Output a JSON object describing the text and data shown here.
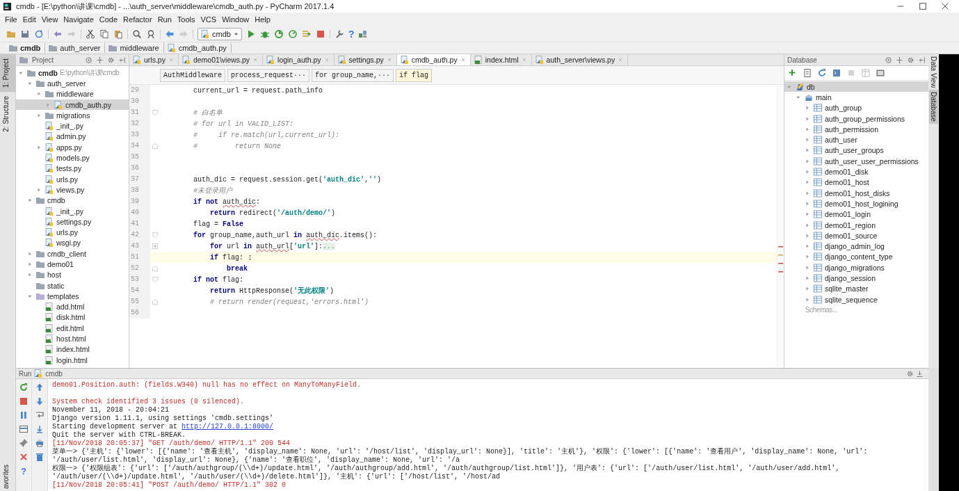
{
  "window": {
    "title": "cmdb - [E:\\python\\讲课\\cmdb] - ...\\auth_server\\middleware\\cmdb_auth.py - PyCharm 2017.1.4"
  },
  "menu": [
    "File",
    "Edit",
    "View",
    "Navigate",
    "Code",
    "Refactor",
    "Run",
    "Tools",
    "VCS",
    "Window",
    "Help"
  ],
  "toolbar": {
    "run_config": "cmdb",
    "help_glyph": "?"
  },
  "nav_bar": [
    {
      "label": "cmdb",
      "kind": "folder"
    },
    {
      "label": "auth_server",
      "kind": "folder"
    },
    {
      "label": "middleware",
      "kind": "folder"
    },
    {
      "label": "cmdb_auth.py",
      "kind": "py"
    }
  ],
  "left_strip": [
    {
      "label": "1: Project",
      "selected": true
    },
    {
      "label": "2: Structure",
      "selected": false
    },
    {
      "label": "avorites",
      "selected": false
    }
  ],
  "project": {
    "title": "Project",
    "tree": [
      {
        "label": "cmdb",
        "kind": "folder",
        "path": "E:\\python\\讲课\\cmdb",
        "expanded": true,
        "selected": false,
        "children": [
          {
            "label": "auth_server",
            "kind": "folder",
            "expanded": true,
            "selected": false,
            "children": [
              {
                "label": "middleware",
                "kind": "folder",
                "expanded": true,
                "selected": false,
                "children": [
                  {
                    "label": "cmdb_auth.py",
                    "kind": "py",
                    "expanded": false,
                    "selected": true
                  }
                ]
              },
              {
                "label": "migrations",
                "kind": "folder",
                "expanded": false,
                "selected": false
              },
              {
                "label": "_init_.py",
                "kind": "py",
                "selected": false
              },
              {
                "label": "admin.py",
                "kind": "py",
                "selected": false
              },
              {
                "label": "apps.py",
                "kind": "py",
                "expanded": false,
                "selected": false
              },
              {
                "label": "models.py",
                "kind": "py",
                "selected": false
              },
              {
                "label": "tests.py",
                "kind": "py",
                "selected": false
              },
              {
                "label": "urls.py",
                "kind": "py",
                "selected": false
              },
              {
                "label": "views.py",
                "kind": "py",
                "expanded": false,
                "selected": false
              }
            ]
          },
          {
            "label": "cmdb",
            "kind": "folder",
            "expanded": true,
            "selected": false,
            "children": [
              {
                "label": "_init_.py",
                "kind": "py",
                "selected": false
              },
              {
                "label": "settings.py",
                "kind": "py",
                "selected": false
              },
              {
                "label": "urls.py",
                "kind": "py",
                "selected": false
              },
              {
                "label": "wsgi.py",
                "kind": "py",
                "selected": false
              }
            ]
          },
          {
            "label": "cmdb_client",
            "kind": "folder",
            "expanded": false,
            "selected": false
          },
          {
            "label": "demo01",
            "kind": "folder",
            "expanded": false,
            "selected": false
          },
          {
            "label": "host",
            "kind": "folder",
            "expanded": false,
            "selected": false
          },
          {
            "label": "static",
            "kind": "folder",
            "selected": false
          },
          {
            "label": "templates",
            "kind": "resource_folder",
            "expanded": true,
            "selected": false,
            "children": [
              {
                "label": "add.html",
                "kind": "html",
                "selected": false
              },
              {
                "label": "disk.html",
                "kind": "html",
                "selected": false
              },
              {
                "label": "edit.html",
                "kind": "html",
                "selected": false
              },
              {
                "label": "host.html",
                "kind": "html",
                "selected": false
              },
              {
                "label": "index.html",
                "kind": "html",
                "selected": false
              },
              {
                "label": "login.html",
                "kind": "html",
                "selected": false
              }
            ]
          }
        ]
      }
    ]
  },
  "editor": {
    "tabs": [
      {
        "label": "urls.py",
        "kind": "py",
        "selected": false
      },
      {
        "label": "demo01\\views.py",
        "kind": "py",
        "selected": false
      },
      {
        "label": "login_auth.py",
        "kind": "py",
        "selected": false
      },
      {
        "label": "settings.py",
        "kind": "py",
        "selected": false
      },
      {
        "label": "cmdb_auth.py",
        "kind": "py",
        "selected": true
      },
      {
        "label": "index.html",
        "kind": "html",
        "selected": false
      },
      {
        "label": "auth_server\\views.py",
        "kind": "py",
        "selected": false
      }
    ],
    "breadcrumbs": [
      {
        "label": "AuthMiddleware",
        "selected": false
      },
      {
        "label": "process_request···",
        "selected": false
      },
      {
        "label": "for group_name,···",
        "selected": false
      },
      {
        "label": "if flag",
        "selected": true
      }
    ],
    "lines": [
      {
        "num": "29",
        "current": false,
        "tokens": [
          {
            "kind": "plain",
            "text": "        current_url = request.path_info"
          }
        ]
      },
      {
        "num": "30",
        "current": false
      },
      {
        "num": "31",
        "current": false,
        "fold_marker": {
          "kind": "start"
        },
        "tokens": [
          {
            "kind": "com",
            "text": "        # 白名单"
          }
        ]
      },
      {
        "num": "32",
        "current": false,
        "tokens": [
          {
            "kind": "com",
            "text": "        # for url in VALID_LIST:"
          }
        ]
      },
      {
        "num": "33",
        "current": false,
        "tokens": [
          {
            "kind": "com",
            "text": "        #     if re.match(url,current_url):"
          }
        ]
      },
      {
        "num": "34",
        "current": false,
        "fold_marker": {
          "kind": "end"
        },
        "tokens": [
          {
            "kind": "com",
            "text": "        #         return None"
          }
        ]
      },
      {
        "num": "35",
        "current": false
      },
      {
        "num": "36",
        "current": false
      },
      {
        "num": "37",
        "current": false,
        "tokens": [
          {
            "kind": "plain",
            "text": "        auth_dic = request.session.get("
          },
          {
            "kind": "str",
            "text": "'auth_dic'"
          },
          {
            "kind": "plain",
            "text": ","
          },
          {
            "kind": "str",
            "text": "''"
          },
          {
            "kind": "plain",
            "text": ")"
          }
        ]
      },
      {
        "num": "38",
        "current": false,
        "tokens": [
          {
            "kind": "com",
            "text": "        #未登录用户"
          }
        ]
      },
      {
        "num": "39",
        "current": false,
        "tokens": [
          {
            "kind": "kw",
            "text": "        if not "
          },
          {
            "kind": "err",
            "text": "auth_dic"
          },
          {
            "kind": "plain",
            "text": ":"
          }
        ]
      },
      {
        "num": "40",
        "current": false,
        "tokens": [
          {
            "kind": "kw",
            "text": "            return"
          },
          {
            "kind": "plain",
            "text": " redirect("
          },
          {
            "kind": "str",
            "text": "'/auth/demo/'"
          },
          {
            "kind": "plain",
            "text": ")"
          }
        ]
      },
      {
        "num": "41",
        "current": false,
        "tokens": [
          {
            "kind": "plain",
            "text": "        flag = "
          },
          {
            "kind": "kw",
            "text": "False"
          }
        ]
      },
      {
        "num": "42",
        "current": false,
        "fold_marker": {
          "kind": "start"
        },
        "tokens": [
          {
            "kind": "kw",
            "text": "        for"
          },
          {
            "kind": "plain",
            "text": " group_name,auth_url "
          },
          {
            "kind": "kw",
            "text": "in "
          },
          {
            "kind": "err",
            "text": "auth_dic"
          },
          {
            "kind": "plain",
            "text": ".items():"
          }
        ]
      },
      {
        "num": "43",
        "current": false,
        "fold_marker": {
          "kind": "collapsed"
        },
        "tokens": [
          {
            "kind": "kw",
            "text": "            for"
          },
          {
            "kind": "plain",
            "text": " url "
          },
          {
            "kind": "kw",
            "text": "in "
          },
          {
            "kind": "err",
            "text": "auth_url"
          },
          {
            "kind": "plain",
            "text": "["
          },
          {
            "kind": "str",
            "text": "'url'"
          },
          {
            "kind": "plain",
            "text": "]:"
          },
          {
            "kind": "folded",
            "text": "..."
          }
        ]
      },
      {
        "num": "51",
        "current": true,
        "tokens": [
          {
            "kind": "kw",
            "text": "            if"
          },
          {
            "kind": "plain",
            "text": " flag: "
          }
        ]
      },
      {
        "num": "52",
        "current": false,
        "fold_marker": {
          "kind": "end"
        },
        "tokens": [
          {
            "kind": "kw",
            "text": "                break"
          }
        ]
      },
      {
        "num": "53",
        "current": false,
        "fold_marker": {
          "kind": "start"
        },
        "tokens": [
          {
            "kind": "kw",
            "text": "        if not"
          },
          {
            "kind": "plain",
            "text": " flag:"
          }
        ]
      },
      {
        "num": "54",
        "current": false,
        "tokens": [
          {
            "kind": "kw",
            "text": "            return"
          },
          {
            "kind": "plain",
            "text": " HttpResponse("
          },
          {
            "kind": "str",
            "text": "'无此权限'"
          },
          {
            "kind": "plain",
            "text": ")"
          }
        ]
      },
      {
        "num": "55",
        "current": false,
        "fold_marker": {
          "kind": "end"
        },
        "tokens": [
          {
            "kind": "com",
            "text": "            # return render(request,'errors.html')"
          }
        ]
      },
      {
        "num": "56",
        "current": false
      }
    ]
  },
  "database": {
    "title": "Database",
    "tree": [
      {
        "label": "db",
        "kind": "datasource",
        "expanded": true,
        "selected": true,
        "children": [
          {
            "label": "main",
            "kind": "schema",
            "expanded": true,
            "selected": false,
            "children": [
              {
                "label": "auth_group",
                "kind": "table",
                "expanded": false,
                "selected": false
              },
              {
                "label": "auth_group_permissions",
                "kind": "table",
                "expanded": false,
                "selected": false
              },
              {
                "label": "auth_permission",
                "kind": "table",
                "expanded": false,
                "selected": false
              },
              {
                "label": "auth_user",
                "kind": "table",
                "expanded": false,
                "selected": false
              },
              {
                "label": "auth_user_groups",
                "kind": "table",
                "expanded": false,
                "selected": false
              },
              {
                "label": "auth_user_user_permissions",
                "kind": "table",
                "expanded": false,
                "selected": false
              },
              {
                "label": "demo01_disk",
                "kind": "table",
                "expanded": false,
                "selected": false
              },
              {
                "label": "demo01_host",
                "kind": "table",
                "expanded": false,
                "selected": false
              },
              {
                "label": "demo01_host_disks",
                "kind": "table",
                "expanded": false,
                "selected": false
              },
              {
                "label": "demo01_host_logining",
                "kind": "table",
                "expanded": false,
                "selected": false
              },
              {
                "label": "demo01_login",
                "kind": "table",
                "expanded": false,
                "selected": false
              },
              {
                "label": "demo01_region",
                "kind": "table",
                "expanded": false,
                "selected": false
              },
              {
                "label": "demo01_source",
                "kind": "table",
                "expanded": false,
                "selected": false
              },
              {
                "label": "django_admin_log",
                "kind": "table",
                "expanded": false,
                "selected": false
              },
              {
                "label": "django_content_type",
                "kind": "table",
                "expanded": false,
                "selected": false
              },
              {
                "label": "django_migrations",
                "kind": "table",
                "expanded": false,
                "selected": false
              },
              {
                "label": "django_session",
                "kind": "table",
                "expanded": false,
                "selected": false
              },
              {
                "label": "sqlite_master",
                "kind": "table",
                "expanded": false,
                "selected": false
              },
              {
                "label": "sqlite_sequence",
                "kind": "table",
                "expanded": false,
                "selected": false
              }
            ]
          }
        ]
      }
    ],
    "schemas": "Schemas..."
  },
  "right_strip": [
    {
      "label": "Data View",
      "selected": false
    },
    {
      "label": "Database",
      "selected": true
    }
  ],
  "run": {
    "label": "Run",
    "config": "cmdb",
    "help_glyph": "?",
    "console": [
      {
        "kind": "error",
        "text": "demo01.Position.auth: (fields.W340) null has no effect on ManyToManyField."
      },
      {
        "kind": "blank"
      },
      {
        "kind": "error",
        "text": "System check identified 3 issues (0 silenced)."
      },
      {
        "kind": "info",
        "text": "November 11, 2018 - 20:04:21"
      },
      {
        "kind": "info",
        "text": "Django version 1.11.1, using settings 'cmdb.settings'"
      },
      {
        "kind": "info",
        "text": "Starting development server at ",
        "link": "http://127.0.0.1:8000/"
      },
      {
        "kind": "info",
        "text": "Quit the server with CTRL-BREAK."
      },
      {
        "kind": "error",
        "text": "[11/Nov/2018 20:05:37] \"GET /auth/demo/ HTTP/1.1\" 200 544"
      },
      {
        "kind": "info",
        "text": "菜单一> {'主机': {'lower': [{'name': '查看主机', 'display_name': None, 'url': '/host/list', 'display_url': None}], 'title': '主机'}, '权限': {'lower': [{'name': '查看用户', 'display_name': None, 'url': '/auth/user/list.html', 'display_url': None}, {'name': '查看职位', 'display_name': None, 'url': '/a"
      },
      {
        "kind": "info",
        "text": "权限一> {'权限组表': {'url': ['/auth/authgroup/(\\\\d+)/update.html', '/auth/authgroup/add.html', '/auth/authgroup/list.html']}, '用户表': {'url': ['/auth/user/list.html', '/auth/user/add.html', '/auth/user/(\\\\d+)/update.html', '/auth/user/(\\\\d+)/delete.html']}, '主机': {'url': ['/host/list', '/host/ad"
      },
      {
        "kind": "error",
        "text": "[11/Nov/2018 20:05:41] \"POST /auth/demo/ HTTP/1.1\" 302 0"
      }
    ]
  }
}
